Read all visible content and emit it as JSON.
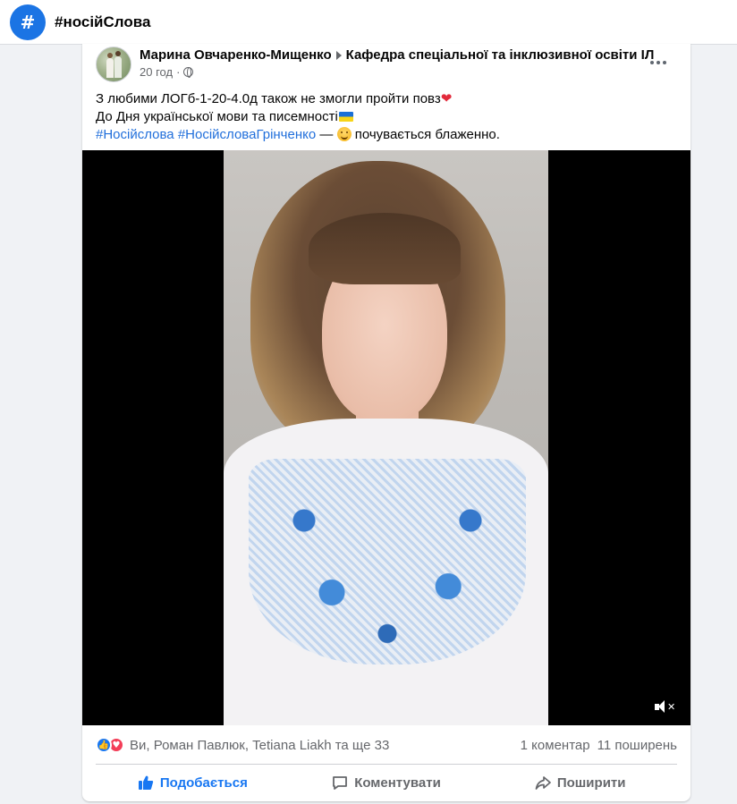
{
  "header": {
    "hash_symbol": "#",
    "title": "#носійСлова"
  },
  "post": {
    "author": "Марина Овчаренко-Мищенко",
    "group": "Кафедра спеціальної та інклюзивної освіти ІЛ",
    "time": "20 год",
    "text_line1": "З любими ЛОГб-1-20-4.0д також не змогли пройти повз",
    "text_line2": "До Дня української мови та писемності",
    "hashtag1": "#Носійслова",
    "hashtag2": "#НосійсловаГрінченко",
    "feeling_prefix": "—",
    "feeling": "почувається блаженно."
  },
  "reactions": {
    "reactors": "Ви, Роман Павлюк, Tetiana Liakh та ще 33",
    "comments": "1 коментар",
    "shares": "11 поширень"
  },
  "actions": {
    "like": "Подобається",
    "comment": "Коментувати",
    "share": "Поширити"
  },
  "colors": {
    "accent": "#1877f2",
    "link": "#216fdb",
    "secondary_text": "#65676b"
  },
  "icons": [
    "hash-icon",
    "globe-icon",
    "more-icon",
    "heart-icon",
    "flag-icon",
    "smile-icon",
    "mute-icon",
    "like-icon",
    "love-icon",
    "comment-icon",
    "share-icon"
  ]
}
